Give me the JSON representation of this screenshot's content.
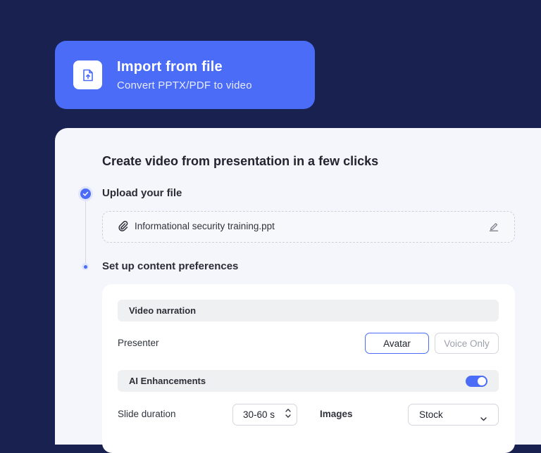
{
  "import_card": {
    "title": "Import from file",
    "subtitle": "Convert PPTX/PDF to video",
    "icon": "file-upload-icon"
  },
  "main": {
    "heading": "Create video from presentation in a few clicks",
    "steps": [
      {
        "label": "Upload your file",
        "status": "done"
      },
      {
        "label": "Set up content preferences",
        "status": "current"
      }
    ],
    "file": {
      "name": "Informational security training.ppt",
      "icon": "paperclip-icon",
      "edit_icon": "pencil-icon"
    },
    "preferences": {
      "video_narration": {
        "title": "Video narration",
        "presenter_label": "Presenter",
        "options": [
          "Avatar",
          "Voice Only"
        ],
        "selected": "Avatar"
      },
      "ai_enhancements": {
        "title": "AI Enhancements",
        "enabled": true,
        "slide_duration_label": "Slide duration",
        "slide_duration_value": "30-60 s",
        "images_label": "Images",
        "images_value": "Stock"
      }
    }
  },
  "colors": {
    "background": "#18214f",
    "accent": "#4a6cf7",
    "panel": "#f4f6fc"
  }
}
